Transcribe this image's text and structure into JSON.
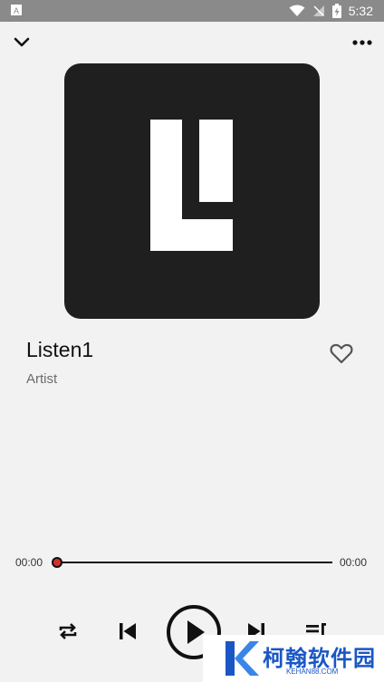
{
  "status_bar": {
    "time": "5:32",
    "icons": [
      "notification-a-icon",
      "wifi-icon",
      "signal-icon",
      "battery-charging-icon"
    ]
  },
  "header": {
    "collapse_icon": "chevron-down-icon",
    "more_icon": "more-horizontal-icon"
  },
  "track": {
    "title": "Listen1",
    "artist": "Artist",
    "favorite_icon": "heart-outline-icon"
  },
  "progress": {
    "elapsed": "00:00",
    "total": "00:00",
    "fraction": 0.0
  },
  "controls": {
    "repeat_icon": "repeat-icon",
    "prev_icon": "skip-previous-icon",
    "play_icon": "play-icon",
    "next_icon": "skip-next-icon",
    "queue_icon": "playlist-icon"
  },
  "watermark": {
    "text": "柯翰软件园",
    "sub": "KEHAN88.COM"
  },
  "colors": {
    "background": "#f2f2f2",
    "status_bar": "#8a8a8a",
    "album_bg": "#1f1f1f",
    "accent_red": "#d32f2f",
    "watermark_blue": "#1a57c4"
  }
}
